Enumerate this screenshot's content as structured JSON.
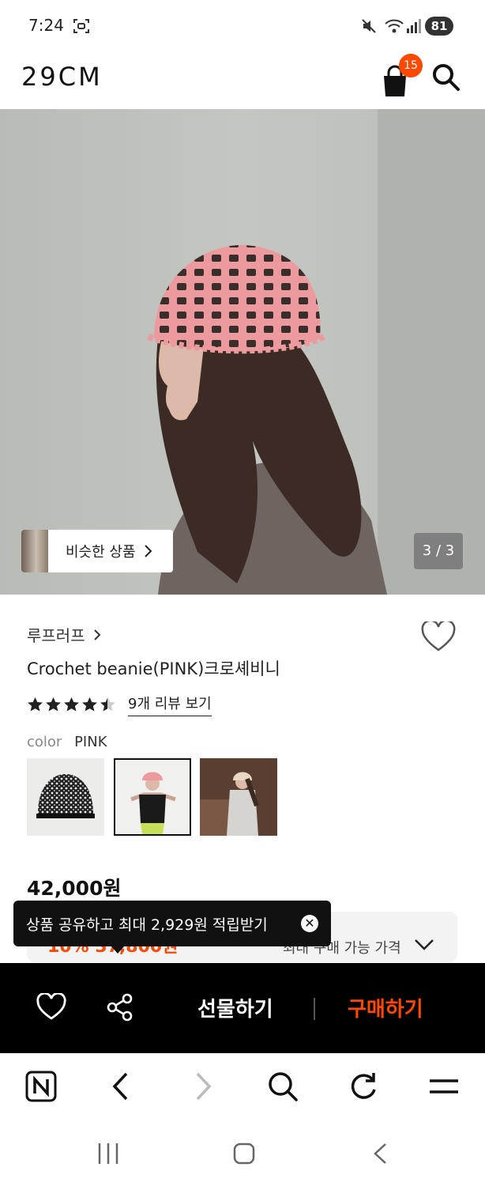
{
  "status": {
    "time": "7:24",
    "battery": "81"
  },
  "header": {
    "logo": "29CM",
    "cart_count": "15"
  },
  "hero": {
    "similar_label": "비슷한 상품",
    "counter": "3 / 3"
  },
  "product": {
    "brand": "루프러프",
    "title": "Crochet beanie(PINK)크로셰비니",
    "rating": 4.5,
    "review_link": "9개 리뷰 보기",
    "color_label": "color",
    "color_value": "PINK",
    "swatches": [
      "black-white",
      "pink",
      "cream"
    ],
    "price": "42,000원"
  },
  "price_box": {
    "discount_text": "10% 37,800원",
    "label": "최대 구매 가능 가격"
  },
  "tooltip": {
    "text": "상품 공유하고 최대 2,929원 적립받기"
  },
  "action_bar": {
    "gift_label": "선물하기",
    "buy_label": "구매하기",
    "accent": "#ff4800"
  }
}
